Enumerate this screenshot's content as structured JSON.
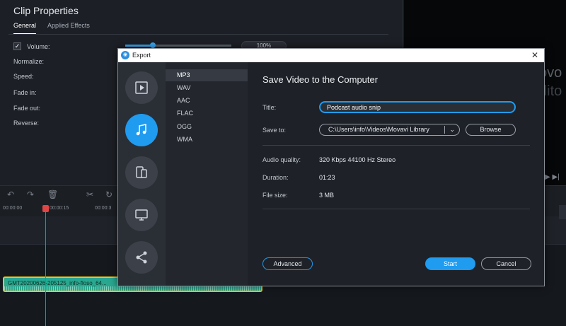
{
  "clip_properties": {
    "title": "Clip Properties",
    "tabs": [
      {
        "label": "General",
        "active": true
      },
      {
        "label": "Applied Effects",
        "active": false
      }
    ],
    "volume_label": "Volume:",
    "volume_value": "100%",
    "volume_level": 0.26,
    "normalize_label": "Normalize:",
    "speed_label": "Speed:",
    "fade_in_label": "Fade in:",
    "fade_out_label": "Fade out:",
    "reverse_label": "Reverse:"
  },
  "preview": {
    "text_line1": "ovo",
    "text_line2": "dito"
  },
  "timeline": {
    "ruler": [
      "00:00:00",
      "00:00:15",
      "00:00:3"
    ],
    "audio_clip_label": "GMT20200626-205125_info-floso_64..."
  },
  "export_dialog": {
    "window_title": "Export",
    "categories": [
      {
        "name": "video",
        "icon": "play-icon",
        "active": false
      },
      {
        "name": "audio",
        "icon": "music-note-icon",
        "active": true
      },
      {
        "name": "devices",
        "icon": "devices-icon",
        "active": false
      },
      {
        "name": "tv",
        "icon": "monitor-icon",
        "active": false
      },
      {
        "name": "share",
        "icon": "share-icon",
        "active": false
      }
    ],
    "formats": [
      {
        "label": "MP3",
        "active": true
      },
      {
        "label": "WAV",
        "active": false
      },
      {
        "label": "AAC",
        "active": false
      },
      {
        "label": "FLAC",
        "active": false
      },
      {
        "label": "OGG",
        "active": false
      },
      {
        "label": "WMA",
        "active": false
      }
    ],
    "heading": "Save Video to the Computer",
    "title_label": "Title:",
    "title_value": "Podcast audio snip",
    "save_to_label": "Save to:",
    "save_to_value": "C:\\Users\\info\\Videos\\Movavi Library",
    "browse_label": "Browse",
    "audio_quality_label": "Audio quality:",
    "audio_quality_value": "320 Kbps 44100 Hz Stereo",
    "duration_label": "Duration:",
    "duration_value": "01:23",
    "file_size_label": "File size:",
    "file_size_value": "3 MB",
    "advanced_label": "Advanced",
    "start_label": "Start",
    "cancel_label": "Cancel",
    "accent_color": "#1f9bf0"
  }
}
